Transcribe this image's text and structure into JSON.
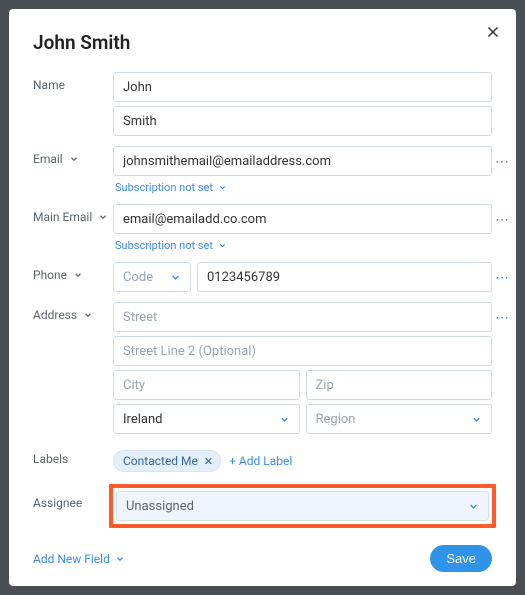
{
  "title": "John Smith",
  "labels": {
    "name": "Name",
    "email": "Email",
    "main_email": "Main Email",
    "phone": "Phone",
    "address": "Address",
    "labels": "Labels",
    "assignee": "Assignee"
  },
  "name": {
    "first": "John",
    "last": "Smith"
  },
  "email": {
    "value": "johnsmithemail@emailaddress.com",
    "subscription_text": "Subscription not set"
  },
  "main_email": {
    "value": "email@emailadd.co.com",
    "subscription_text": "Subscription not set"
  },
  "phone": {
    "code_placeholder": "Code",
    "number": "0123456789"
  },
  "address": {
    "street_placeholder": "Street",
    "street2_placeholder": "Street Line 2 (Optional)",
    "city_placeholder": "City",
    "zip_placeholder": "Zip",
    "country": "Ireland",
    "region_placeholder": "Region"
  },
  "tag": {
    "text": "Contacted Me",
    "add": "+ Add Label"
  },
  "assignee": {
    "value": "Unassigned"
  },
  "footer": {
    "add_field": "Add New Field",
    "save": "Save"
  }
}
